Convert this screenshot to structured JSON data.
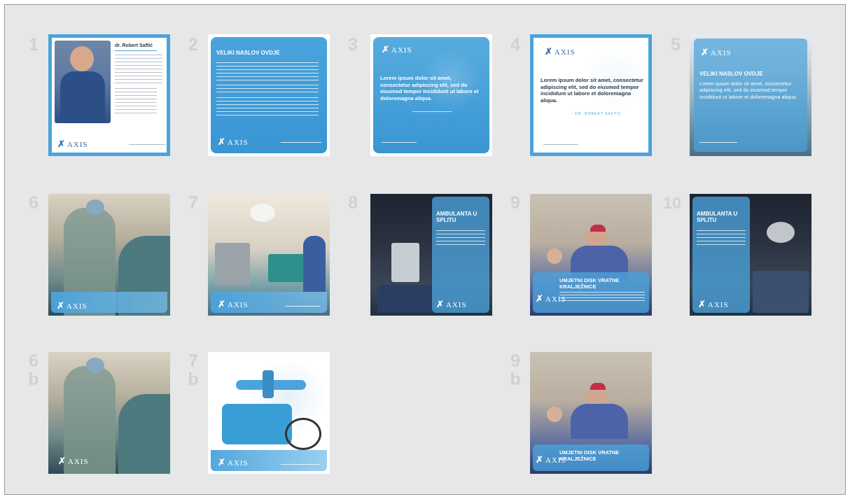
{
  "brand": {
    "logo_text": "AXIS",
    "accent_color": "#4aa3dc",
    "background_color": "#e6e7e8"
  },
  "slides": [
    {
      "number": "1",
      "doctor_name": "dr. Robert Saftić",
      "icon": "x-figure-icon"
    },
    {
      "number": "2",
      "heading": "VELIKI NASLOV OVDJE"
    },
    {
      "number": "3",
      "quote": "Lorem ipsum dolor sit amet, consectetur adipiscing elit, sed do eiusmod tempor incididunt ut labore et doloremagna aliqua."
    },
    {
      "number": "4",
      "quote": "Lorem ipsum dolor sit amet, consectetur adipiscing elit, sed do eiusmod tempor incididunt ut labore et doloremagna aliqua.",
      "signature": "- DR. ROBERT SAFTIĆ"
    },
    {
      "number": "5",
      "heading": "VELIKI NASLOV OVDJE",
      "text": "Lorem ipsum dolor sit amet, consectetur adipiscing elit, sed do eiusmod tempor incididunt ut labore et doloremagna aliqua."
    },
    {
      "number": "6"
    },
    {
      "number": "7"
    },
    {
      "number": "8",
      "heading": "AMBULANTA U SPLITU"
    },
    {
      "number": "9",
      "heading": "UMJETNI DISK VRATNE KRALJEŽNICE"
    },
    {
      "number": "10",
      "heading": "AMBULANTA U SPLITU"
    },
    {
      "number": "6",
      "suffix": "b"
    },
    {
      "number": "7",
      "suffix": "b"
    },
    {
      "number": "9",
      "suffix": "b",
      "heading": "UMJETNI DISK VRATNE KRALJEŽNICE"
    }
  ]
}
